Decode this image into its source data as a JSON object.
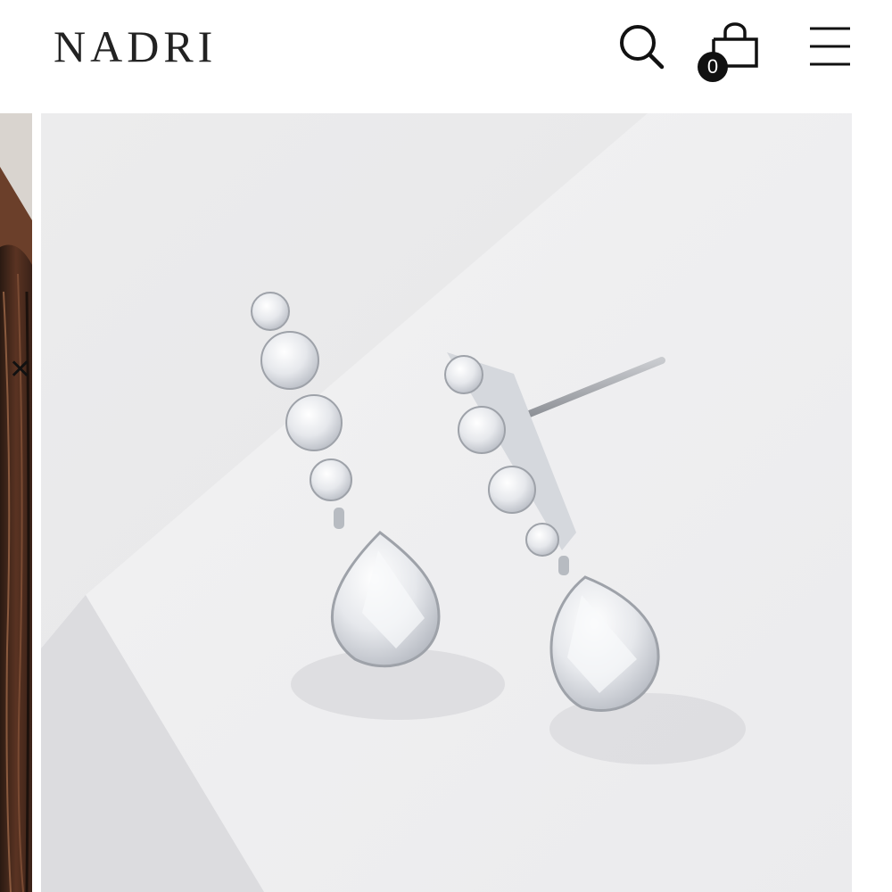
{
  "header": {
    "logo_text": "NADRI",
    "cart_count": "0"
  },
  "icons": {
    "search": "search-icon",
    "cart": "shopping-bag-icon",
    "menu": "hamburger-menu-icon",
    "close": "close-icon"
  },
  "gallery": {
    "close_symbol": "✕",
    "main_image": "drop-earrings-product-photo",
    "prev_image": "model-hair-photo"
  },
  "colors": {
    "text": "#222222",
    "badge_bg": "#111111",
    "backdrop": "#ececee"
  }
}
